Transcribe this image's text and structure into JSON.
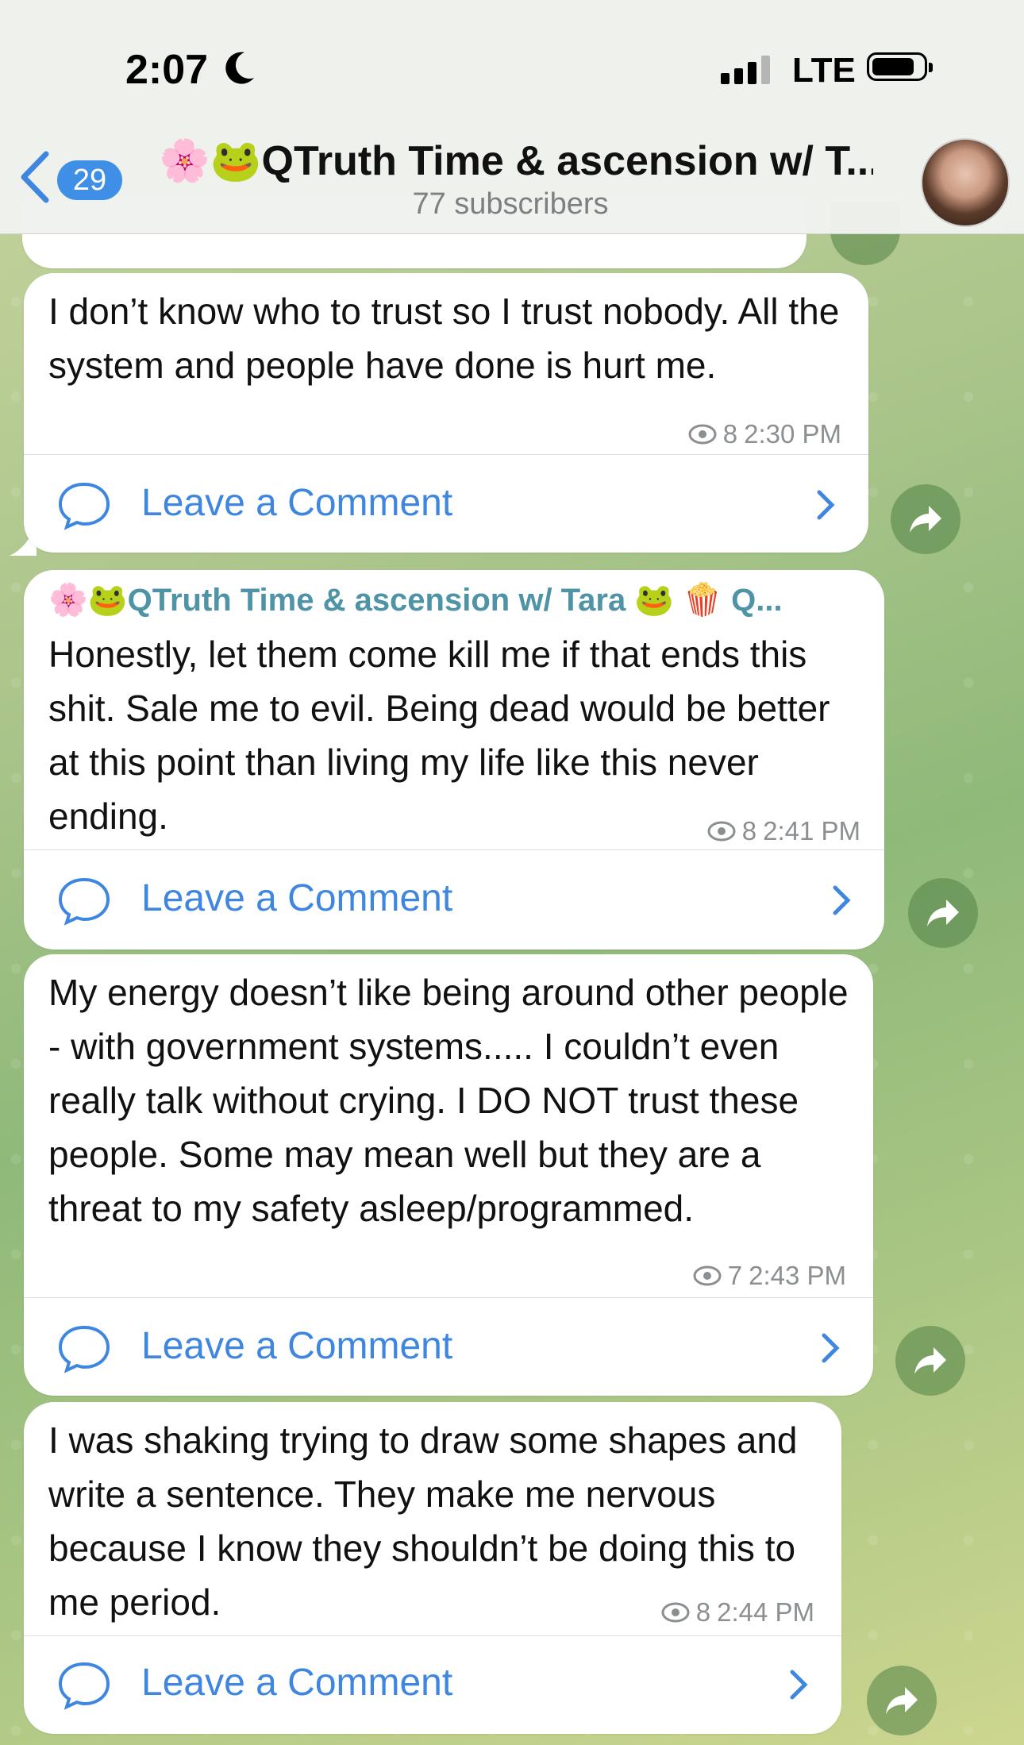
{
  "status_bar": {
    "time": "2:07",
    "network": "LTE"
  },
  "header": {
    "back_count": "29",
    "title": "🌸🐸QTruth Time & ascension w/ T...",
    "subtitle": "77 subscribers"
  },
  "messages": [
    {
      "text": "I don’t know who to trust so I trust nobody. All the system and people have done is hurt me.",
      "views": "8",
      "time": "2:30 PM",
      "comment_label": "Leave a Comment"
    },
    {
      "author": "🌸🐸QTruth Time & ascension w/ Tara 🐸 🍿 Q...",
      "text": "Honestly, let them come kill me if that ends this shit.  Sale me to evil.  Being dead would be better at this point than living my life like this never ending.",
      "views": "8",
      "time": "2:41 PM",
      "comment_label": "Leave a Comment"
    },
    {
      "text": "My energy doesn’t like being around other people - with government systems.....  I couldn’t even really talk without crying.    I DO NOT trust these people.   Some may mean well but they are a threat to my safety asleep/programmed.",
      "views": "7",
      "time": "2:43 PM",
      "comment_label": "Leave a Comment"
    },
    {
      "text": "I was shaking trying to draw some shapes and write a sentence.  They make me nervous because I know they shouldn’t be doing this to me period.",
      "views": "8",
      "time": "2:44 PM",
      "comment_label": "Leave a Comment"
    }
  ],
  "colors": {
    "accent": "#3f86e0",
    "author": "#4f93a6"
  }
}
